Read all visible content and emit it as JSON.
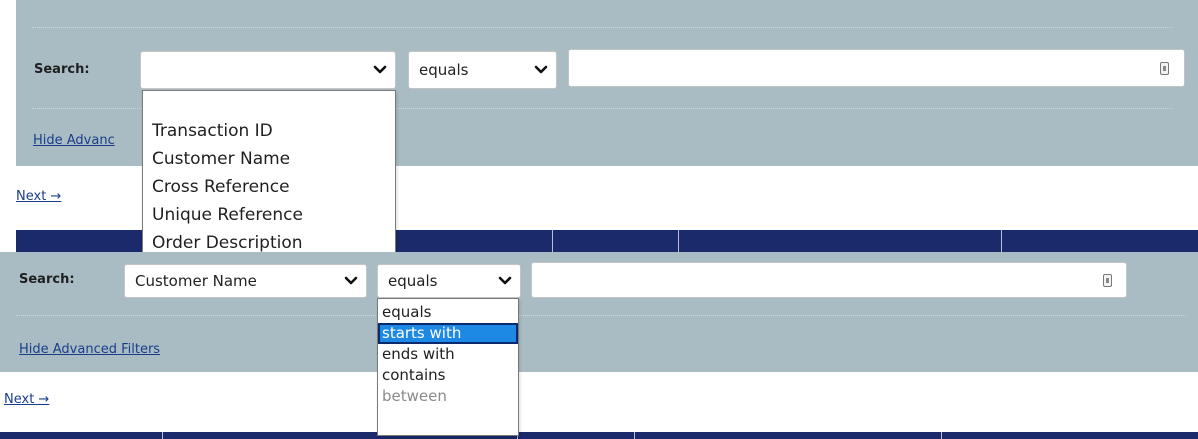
{
  "colors": {
    "panel_bg": "#a9bcc3",
    "header_navy": "#1b2a6b",
    "link": "#1a3d8a",
    "selected_option": "#1e88e5"
  },
  "top": {
    "search_label": "Search:",
    "field_select_value": "",
    "operator_select_value": "equals",
    "search_value": "",
    "hide_filters_link": "Hide Advanced Filters",
    "hide_filters_visible": "Hide Advanc",
    "next_link": "Next →",
    "field_options": [
      "",
      "Transaction ID",
      "Customer Name",
      "Cross Reference",
      "Unique Reference",
      "Order Description"
    ]
  },
  "bottom": {
    "search_label": "Search:",
    "field_select_value": "Customer Name",
    "operator_select_value": "equals",
    "search_value": "",
    "hide_filters_link": "Hide Advanced Filters",
    "next_link": "Next →",
    "operator_options": [
      {
        "label": "equals",
        "state": "normal"
      },
      {
        "label": "starts with",
        "state": "selected"
      },
      {
        "label": "ends with",
        "state": "normal"
      },
      {
        "label": "contains",
        "state": "normal"
      },
      {
        "label": "between",
        "state": "disabled"
      }
    ]
  },
  "icons": {
    "select_arrow": "chevron-down-icon",
    "input_helper": "keyboard-icon"
  }
}
